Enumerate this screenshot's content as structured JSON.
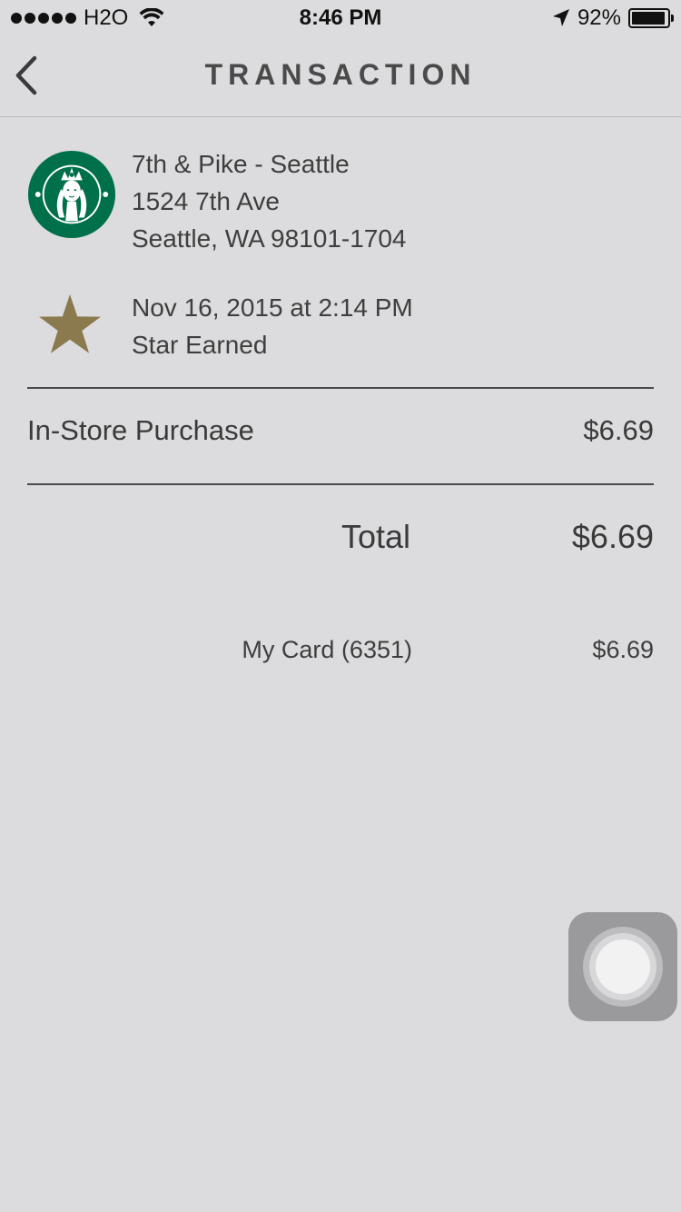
{
  "status_bar": {
    "carrier": "H2O",
    "time": "8:46 PM",
    "battery": "92%",
    "battery_level": 0.92
  },
  "nav": {
    "title": "TRANSACTION"
  },
  "store": {
    "name": "7th & Pike - Seattle",
    "street": "1524 7th Ave",
    "city": "Seattle, WA 98101-1704"
  },
  "transaction": {
    "datetime": "Nov 16, 2015 at 2:14 PM",
    "reward": "Star Earned"
  },
  "items": [
    {
      "label": "In-Store Purchase",
      "amount": "$6.69"
    }
  ],
  "total": {
    "label": "Total",
    "amount": "$6.69"
  },
  "payment": {
    "label": "My Card (6351)",
    "amount": "$6.69"
  },
  "colors": {
    "background": "#dcdcde",
    "text": "#3a3a3a",
    "star": "#8a7a4e",
    "logo_green": "#00704a"
  }
}
